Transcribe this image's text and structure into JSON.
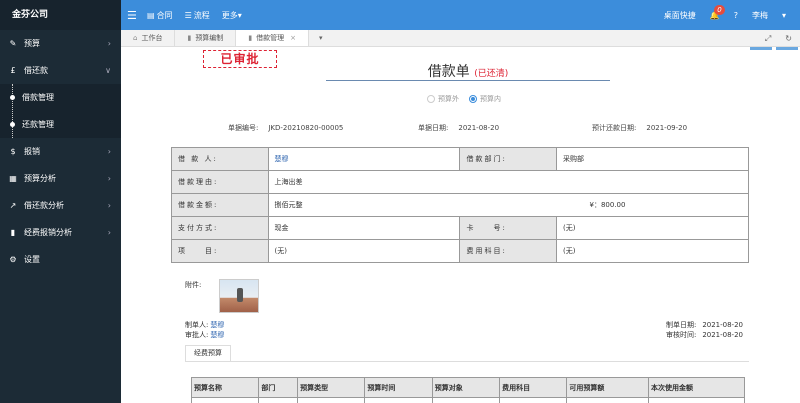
{
  "sidebar": {
    "brand": "金芬公司",
    "items": [
      {
        "icon": "edit-icon",
        "glyph": "✎",
        "label": "预算",
        "arrow": "›"
      },
      {
        "icon": "pound-icon",
        "glyph": "£",
        "label": "借还款",
        "arrow": "∨"
      },
      {
        "icon": "dollar-icon",
        "glyph": "$",
        "label": "报销",
        "arrow": "›"
      },
      {
        "icon": "table-icon",
        "glyph": "▦",
        "label": "预算分析",
        "arrow": "›"
      },
      {
        "icon": "line-chart-icon",
        "glyph": "↗",
        "label": "借还款分析",
        "arrow": "›"
      },
      {
        "icon": "bar-chart-icon",
        "glyph": "▮",
        "label": "经费报销分析",
        "arrow": "›"
      },
      {
        "icon": "gear-icon",
        "glyph": "⚙",
        "label": "设置",
        "arrow": ""
      }
    ],
    "sub_items": [
      "借款管理",
      "还款管理"
    ]
  },
  "topbar": {
    "links": [
      {
        "glyph": "▤",
        "label": "合同"
      },
      {
        "glyph": "☰",
        "label": "流程"
      },
      {
        "glyph": "",
        "label": "更多▾"
      }
    ],
    "shortcut": "桌面快捷",
    "badge": "0",
    "help": "?",
    "user": "李梅",
    "user_arrow": "▾"
  },
  "tabs": [
    {
      "glyph": "⌂",
      "label": "工作台",
      "active": false
    },
    {
      "glyph": "▮",
      "label": "预算编制",
      "active": false
    },
    {
      "glyph": "▮",
      "label": "借款管理",
      "active": true
    }
  ],
  "tab_close": "×",
  "tab_drop": "▾",
  "tab_tools": {
    "expand": "⤢",
    "refresh": "↻"
  },
  "stamp": "已审批",
  "doc": {
    "title": "借款单",
    "status": "(已还清)",
    "radio_off": "预算外",
    "radio_on": "预算内",
    "no_label": "单据编号:",
    "no_value": "JKD-20210820-00005",
    "date_label": "单据日期:",
    "date_value": "2021-08-20",
    "expect_label": "预计还款日期:",
    "expect_value": "2021-09-20",
    "rows": {
      "borrower_label": "借 款 人:",
      "borrower_value": "楚穆",
      "dept_label": "借款部门:",
      "dept_value": "采购部",
      "reason_label": "借款理由:",
      "reason_value": "上海出差",
      "amount_label": "借款金额:",
      "amount_cn": "捌佰元整",
      "amount_num": "¥：800.00",
      "pay_label": "支付方式:",
      "pay_value": "现金",
      "card_label": "卡　　号:",
      "card_value": "(无)",
      "project_label": "项　　目:",
      "project_value": "(无)",
      "subject_label": "费用科目:",
      "subject_value": "(无)"
    },
    "attach_label": "附件:",
    "maker_label": "制单人:",
    "maker_value": "楚穆",
    "auditor_label": "审批人:",
    "auditor_value": "楚穆",
    "make_time_label": "制单日期:",
    "make_time_value": "2021-08-20",
    "audit_time_label": "审核时间:",
    "audit_time_value": "2021-08-20",
    "subtab": "经费预算",
    "budget_headers": [
      "预算名称",
      "部门",
      "预算类型",
      "预算时间",
      "预算对象",
      "费用科目",
      "可用预算额",
      "本次使用金额"
    ]
  }
}
